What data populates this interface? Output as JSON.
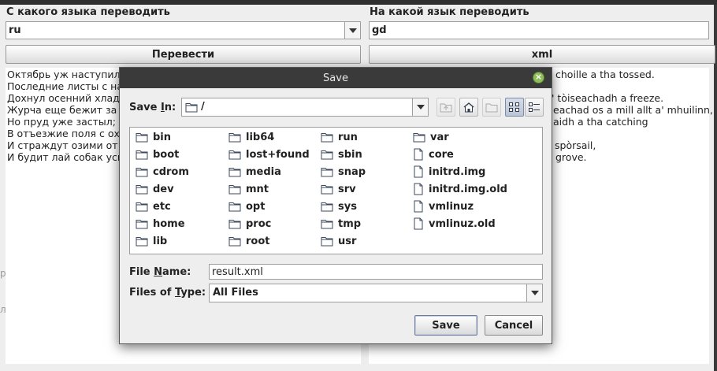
{
  "app": {
    "source_label": "С какого языка переводить",
    "target_label": "На какой язык переводить",
    "source_lang": "ru",
    "target_lang": "gd",
    "translate_button": "Перевести",
    "xml_button": "xml",
    "source_lines": [
      "Октябрь уж наступил -",
      "Последние листы с на",
      "Дохнул осенний хлад -",
      "Журча еще бежит за м",
      "Но пруд уже застыл; с",
      "В отъезжие поля с охо",
      "И страждут озими от б",
      "И будит лай собак усн"
    ],
    "target_lines": [
      "choille a tha tossed.",
      "",
      "' tòiseachadh a freeze.",
      "eachad os a mill allt a' mhuilinn,",
      "aidh a tha catching",
      "",
      "spòrsail,",
      "grove."
    ],
    "left_bg_fragment": "р",
    "left_bg_fragment2": "л"
  },
  "dialog": {
    "title": "Save",
    "save_in_label_pre": "Save ",
    "save_in_label_mnemonic": "I",
    "save_in_label_post": "n:",
    "save_in_value": "/",
    "files": [
      {
        "name": "bin",
        "type": "folder"
      },
      {
        "name": "boot",
        "type": "folder"
      },
      {
        "name": "cdrom",
        "type": "folder"
      },
      {
        "name": "dev",
        "type": "folder"
      },
      {
        "name": "etc",
        "type": "folder"
      },
      {
        "name": "home",
        "type": "folder"
      },
      {
        "name": "lib",
        "type": "folder"
      },
      {
        "name": "lib64",
        "type": "folder"
      },
      {
        "name": "lost+found",
        "type": "folder"
      },
      {
        "name": "media",
        "type": "folder"
      },
      {
        "name": "mnt",
        "type": "folder"
      },
      {
        "name": "opt",
        "type": "folder"
      },
      {
        "name": "proc",
        "type": "folder"
      },
      {
        "name": "root",
        "type": "folder"
      },
      {
        "name": "run",
        "type": "folder"
      },
      {
        "name": "sbin",
        "type": "folder"
      },
      {
        "name": "snap",
        "type": "folder"
      },
      {
        "name": "srv",
        "type": "folder"
      },
      {
        "name": "sys",
        "type": "folder"
      },
      {
        "name": "tmp",
        "type": "folder"
      },
      {
        "name": "usr",
        "type": "folder"
      },
      {
        "name": "var",
        "type": "folder"
      },
      {
        "name": "core",
        "type": "file"
      },
      {
        "name": "initrd.img",
        "type": "file"
      },
      {
        "name": "initrd.img.old",
        "type": "file"
      },
      {
        "name": "vmlinuz",
        "type": "file"
      },
      {
        "name": "vmlinuz.old",
        "type": "file"
      }
    ],
    "file_name_label_pre": "File ",
    "file_name_label_mnemonic": "N",
    "file_name_label_post": "ame:",
    "file_name_value": "result.xml",
    "file_type_label_pre": "Files of ",
    "file_type_label_mnemonic": "T",
    "file_type_label_post": "ype:",
    "file_type_value": "All Files",
    "save_button": "Save",
    "cancel_button": "Cancel",
    "toolbar_icons": [
      "up-one-level-icon",
      "home-icon",
      "new-folder-icon",
      "list-view-icon",
      "details-view-icon"
    ]
  }
}
